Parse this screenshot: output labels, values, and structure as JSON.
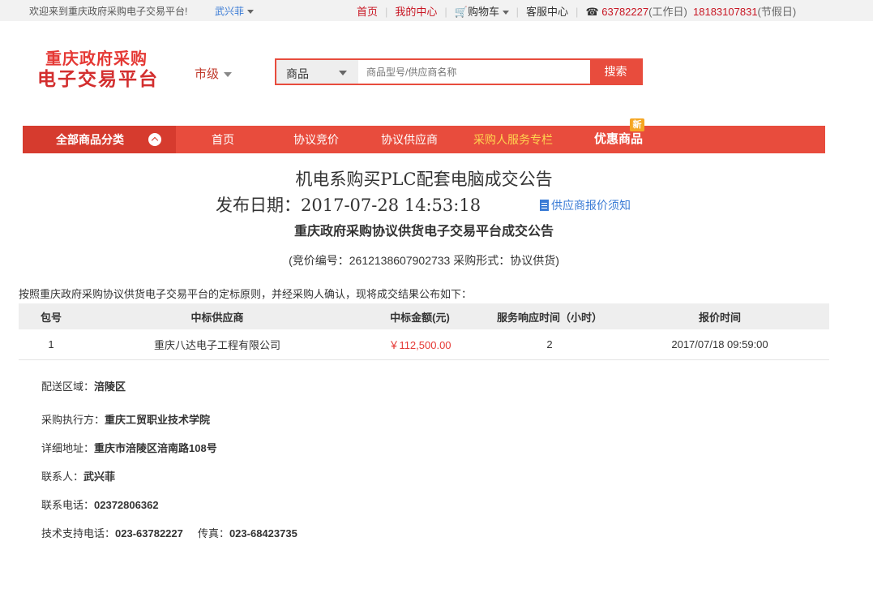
{
  "topbar": {
    "welcome": "欢迎来到重庆政府采购电子交易平台!",
    "user": "武兴菲",
    "links": {
      "home": "首页",
      "my_center": "我的中心",
      "cart": "购物车",
      "service": "客服中心",
      "phone1": "63782227",
      "phone1_note": "(工作日)",
      "phone2": "18183107831",
      "phone2_note": "(节假日)"
    }
  },
  "header": {
    "logo_line1": "重庆政府采购",
    "logo_line2": "电子交易平台",
    "level": "市级",
    "search": {
      "category": "商品",
      "placeholder": "商品型号/供应商名称",
      "button": "搜索"
    }
  },
  "nav": {
    "all_categories": "全部商品分类",
    "items": [
      "首页",
      "协议竞价",
      "协议供应商",
      "采购人服务专栏",
      "优惠商品"
    ],
    "new_tag": "新"
  },
  "announcement": {
    "title": "机电系购买PLC配套电脑成交公告",
    "publish_date": "发布日期：2017-07-28 14:53:18",
    "notice_link": "供应商报价须知",
    "subtitle": "重庆政府采购协议供货电子交易平台成交公告",
    "bid_info": "(竞价编号：2612138607902733   采购形式：协议供货)",
    "intro": "按照重庆政府采购协议供货电子交易平台的定标原则，并经采购人确认，现将成交结果公布如下："
  },
  "result_table": {
    "headers": [
      "包号",
      "中标供应商",
      "中标金额(元)",
      "服务响应时间（小时）",
      "报价时间"
    ],
    "rows": [
      [
        "1",
        "重庆八达电子工程有限公司",
        "￥112,500.00",
        "2",
        "2017/07/18 09:59:00"
      ]
    ]
  },
  "details": {
    "delivery_label": "配送区域：",
    "delivery_value": "涪陵区",
    "executor_label": "采购执行方：",
    "executor_value": "重庆工贸职业技术学院",
    "address_label": "详细地址：",
    "address_value": "重庆市涪陵区涪南路108号",
    "contact_label": "联系人：",
    "contact_value": "武兴菲",
    "phone_label": "联系电话：",
    "phone_value": "02372806362",
    "support_label": "技术支持电话：",
    "support_value": "023-63782227",
    "fax_label": "传真：",
    "fax_value": "023-68423735"
  },
  "colors": {
    "brand_red": "#e84c3d",
    "nav_highlight": "#ffd54f",
    "link_blue": "#3a7bd5"
  }
}
